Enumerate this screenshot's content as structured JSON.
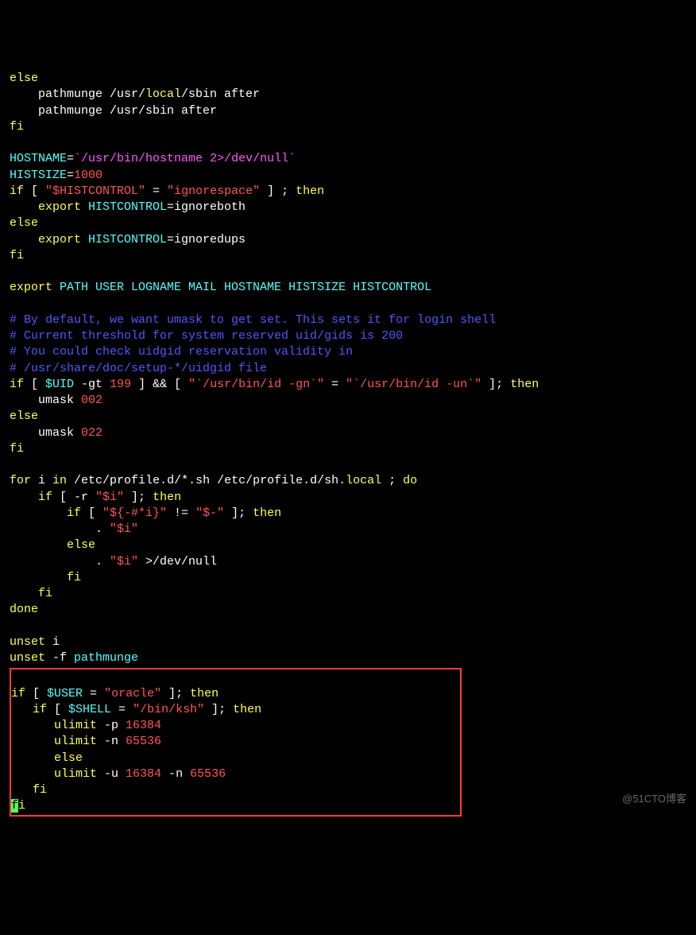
{
  "code": {
    "l01_else": "else",
    "l02a": "    pathmunge /usr/",
    "l02b": "local",
    "l02c": "/sbin after",
    "l03": "    pathmunge /usr/sbin after",
    "l04_fi": "fi",
    "l05_blank": "",
    "l06a": "HOSTNAME",
    "l06b": "=",
    "l06c": "`/usr/bin/hostname ",
    "l06d": "2",
    "l06e": ">/dev/null`",
    "l07a": "HISTSIZE",
    "l07b": "=",
    "l07c": "1000",
    "l08a": "if",
    "l08b": " [ ",
    "l08c": "\"$HISTCONTROL\"",
    "l08d": " = ",
    "l08e": "\"ignorespace\"",
    "l08f": " ] ; ",
    "l08g": "then",
    "l09a": "    export",
    "l09b": " HISTCONTROL",
    "l09c": "=ignoreboth",
    "l10_else": "else",
    "l11a": "    export",
    "l11b": " HISTCONTROL",
    "l11c": "=ignoredups",
    "l12_fi": "fi",
    "l13_blank": "",
    "l14a": "export",
    "l14b": " PATH USER LOGNAME MAIL HOSTNAME HISTSIZE HISTCONTROL",
    "l15_blank": "",
    "c1": "# By default, we want umask to get set. This sets it for login shell",
    "c2": "# Current threshold for system reserved uid/gids is 200",
    "c3": "# You could check uidgid reservation validity in",
    "c4": "# /usr/share/doc/setup-*/uidgid file",
    "l20a": "if",
    "l20b": " [ ",
    "l20c": "$UID",
    "l20d": " -gt ",
    "l20e": "199",
    "l20f": " ] && [ ",
    "l20g": "\"`/usr/bin/id -gn`\"",
    "l20h": " = ",
    "l20i": "\"`/usr/bin/id -un`\"",
    "l20j": " ]; ",
    "l20k": "then",
    "l21a": "    umask ",
    "l21b": "002",
    "l22_else": "else",
    "l23a": "    umask ",
    "l23b": "022",
    "l24_fi": "fi",
    "l25_blank": "",
    "l26a": "for",
    "l26b": " i ",
    "l26c": "in",
    "l26d": " /etc/profile.d/*.sh /etc/profile.d/sh.",
    "l26e": "local",
    "l26f": " ; ",
    "l26g": "do",
    "l27a": "    if",
    "l27b": " [ -r ",
    "l27c": "\"$i\"",
    "l27d": " ]; ",
    "l27e": "then",
    "l28a": "        if",
    "l28b": " [ ",
    "l28c": "\"${-#*i}\"",
    "l28d": " != ",
    "l28e": "\"$-\"",
    "l28f": " ]; ",
    "l28g": "then",
    "l29a": "            . ",
    "l29b": "\"$i\"",
    "l30": "        else",
    "l31a": "            . ",
    "l31b": "\"$i\"",
    "l31c": " >/dev/null",
    "l32": "        fi",
    "l33": "    fi",
    "l34": "done",
    "l35_blank": "",
    "l36a": "unset",
    "l36b": " i",
    "l37a": "unset",
    "l37b": " -f ",
    "l37c": "pathmunge",
    "box_blank": "",
    "b1a": "if",
    "b1b": " [ ",
    "b1c": "$USER",
    "b1d": " = ",
    "b1e": "\"oracle\"",
    "b1f": " ]; ",
    "b1g": "then",
    "b2a": "   if",
    "b2b": " [ ",
    "b2c": "$SHELL",
    "b2d": " = ",
    "b2e": "\"/bin/ksh\"",
    "b2f": " ]; ",
    "b2g": "then",
    "b3a": "      ulimit",
    "b3b": " -p ",
    "b3c": "16384",
    "b4a": "      ulimit",
    "b4b": " -n ",
    "b4c": "65536",
    "b5": "      else",
    "b6a": "      ulimit",
    "b6b": " -u ",
    "b6c": "16384",
    "b6d": " -n ",
    "b6e": "65536",
    "b7": "   fi",
    "b8_cursor": "f",
    "b8_rest": "i"
  },
  "watermark": "@51CTO博客"
}
